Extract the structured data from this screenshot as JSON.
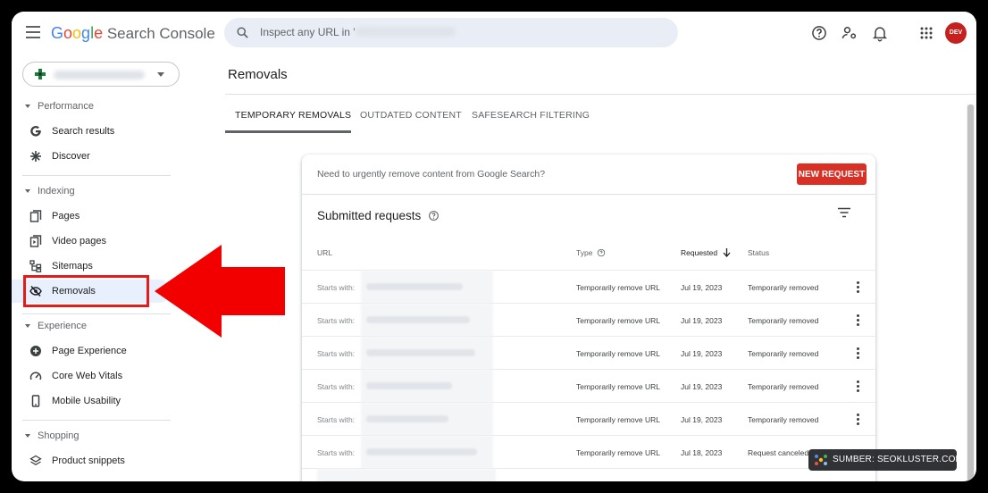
{
  "app": {
    "brand_word": "Google",
    "product": "Search Console"
  },
  "search": {
    "placeholder": "Inspect any URL in '"
  },
  "avatar": {
    "initials": "DEV"
  },
  "sidebar": {
    "sections": [
      {
        "title": "Performance",
        "items": [
          {
            "label": "Search results",
            "icon": "google-g-icon"
          },
          {
            "label": "Discover",
            "icon": "asterisk-icon"
          }
        ]
      },
      {
        "title": "Indexing",
        "items": [
          {
            "label": "Pages",
            "icon": "pages-icon"
          },
          {
            "label": "Video pages",
            "icon": "video-pages-icon"
          },
          {
            "label": "Sitemaps",
            "icon": "sitemap-icon"
          },
          {
            "label": "Removals",
            "icon": "eye-off-icon",
            "active": true
          }
        ]
      },
      {
        "title": "Experience",
        "items": [
          {
            "label": "Page Experience",
            "icon": "plus-circle-icon"
          },
          {
            "label": "Core Web Vitals",
            "icon": "gauge-icon"
          },
          {
            "label": "Mobile Usability",
            "icon": "phone-icon"
          }
        ]
      },
      {
        "title": "Shopping",
        "items": [
          {
            "label": "Product snippets",
            "icon": "layers-icon"
          }
        ]
      }
    ]
  },
  "page": {
    "title": "Removals"
  },
  "tabs": [
    {
      "label": "TEMPORARY REMOVALS",
      "active": true
    },
    {
      "label": "OUTDATED CONTENT"
    },
    {
      "label": "SAFESEARCH FILTERING"
    }
  ],
  "card": {
    "prompt": "Need to urgently remove content from Google Search?",
    "new_request_label": "NEW REQUEST",
    "title": "Submitted requests",
    "columns": {
      "url": "URL",
      "type": "Type",
      "requested": "Requested",
      "status": "Status"
    },
    "rows": [
      {
        "prefix": "Starts with:",
        "type": "Temporarily remove URL",
        "date": "Jul 19, 2023",
        "status": "Temporarily removed"
      },
      {
        "prefix": "Starts with:",
        "type": "Temporarily remove URL",
        "date": "Jul 19, 2023",
        "status": "Temporarily removed"
      },
      {
        "prefix": "Starts with:",
        "type": "Temporarily remove URL",
        "date": "Jul 19, 2023",
        "status": "Temporarily removed"
      },
      {
        "prefix": "Starts with:",
        "type": "Temporarily remove URL",
        "date": "Jul 19, 2023",
        "status": "Temporarily removed"
      },
      {
        "prefix": "Starts with:",
        "type": "Temporarily remove URL",
        "date": "Jul 19, 2023",
        "status": "Temporarily removed"
      },
      {
        "prefix": "Starts with:",
        "type": "Temporarily remove URL",
        "date": "Jul 18, 2023",
        "status": "Request canceled"
      }
    ]
  },
  "watermark": {
    "text": "SUMBER: SEOKLUSTER.COM"
  },
  "colors": {
    "accent_red": "#d93025",
    "annotation_red": "#e31b1b",
    "active_bg": "#e8f0fe"
  }
}
